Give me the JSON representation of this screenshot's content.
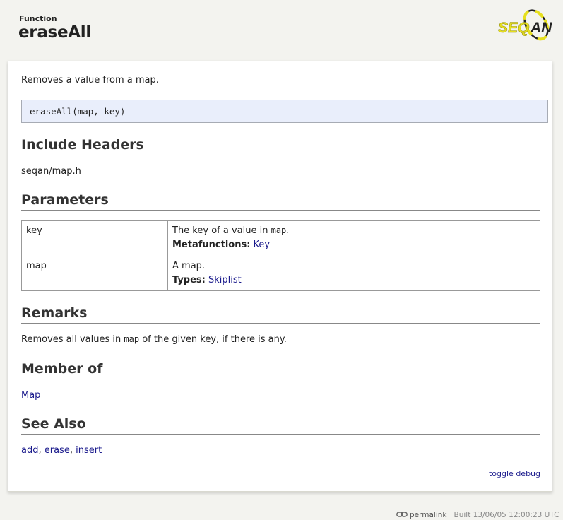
{
  "header": {
    "kind": "Function",
    "title": "eraseAll",
    "logo_text": "SEQAN"
  },
  "description": "Removes a value from a map.",
  "signature": "eraseAll(map, key)",
  "sections": {
    "include_headers": {
      "heading": "Include Headers",
      "value": "seqan/map.h"
    },
    "parameters": {
      "heading": "Parameters",
      "rows": [
        {
          "name": "key",
          "desc_prefix": "The key of a value in ",
          "desc_code": "map",
          "desc_suffix": ".",
          "meta_label": "Metafunctions:",
          "meta_links": [
            "Key"
          ]
        },
        {
          "name": "map",
          "desc_prefix": "A map.",
          "desc_code": "",
          "desc_suffix": "",
          "meta_label": "Types:",
          "meta_links": [
            "Skiplist"
          ]
        }
      ]
    },
    "remarks": {
      "heading": "Remarks",
      "prefix": "Removes all values in ",
      "code": "map",
      "suffix": " of the given key, if there is any."
    },
    "member_of": {
      "heading": "Member of",
      "link": "Map"
    },
    "see_also": {
      "heading": "See Also",
      "links": [
        "add",
        "erase",
        "insert"
      ],
      "separator": ", "
    }
  },
  "toggle_debug": "toggle debug",
  "footer": {
    "permalink": "permalink",
    "built": "Built 13/06/05 12:00:23 UTC"
  },
  "colors": {
    "link": "#1a1a8c",
    "signature_bg": "#e9eefb",
    "logo_yellow": "#e6df1e",
    "page_bg": "#f3f3ef"
  }
}
